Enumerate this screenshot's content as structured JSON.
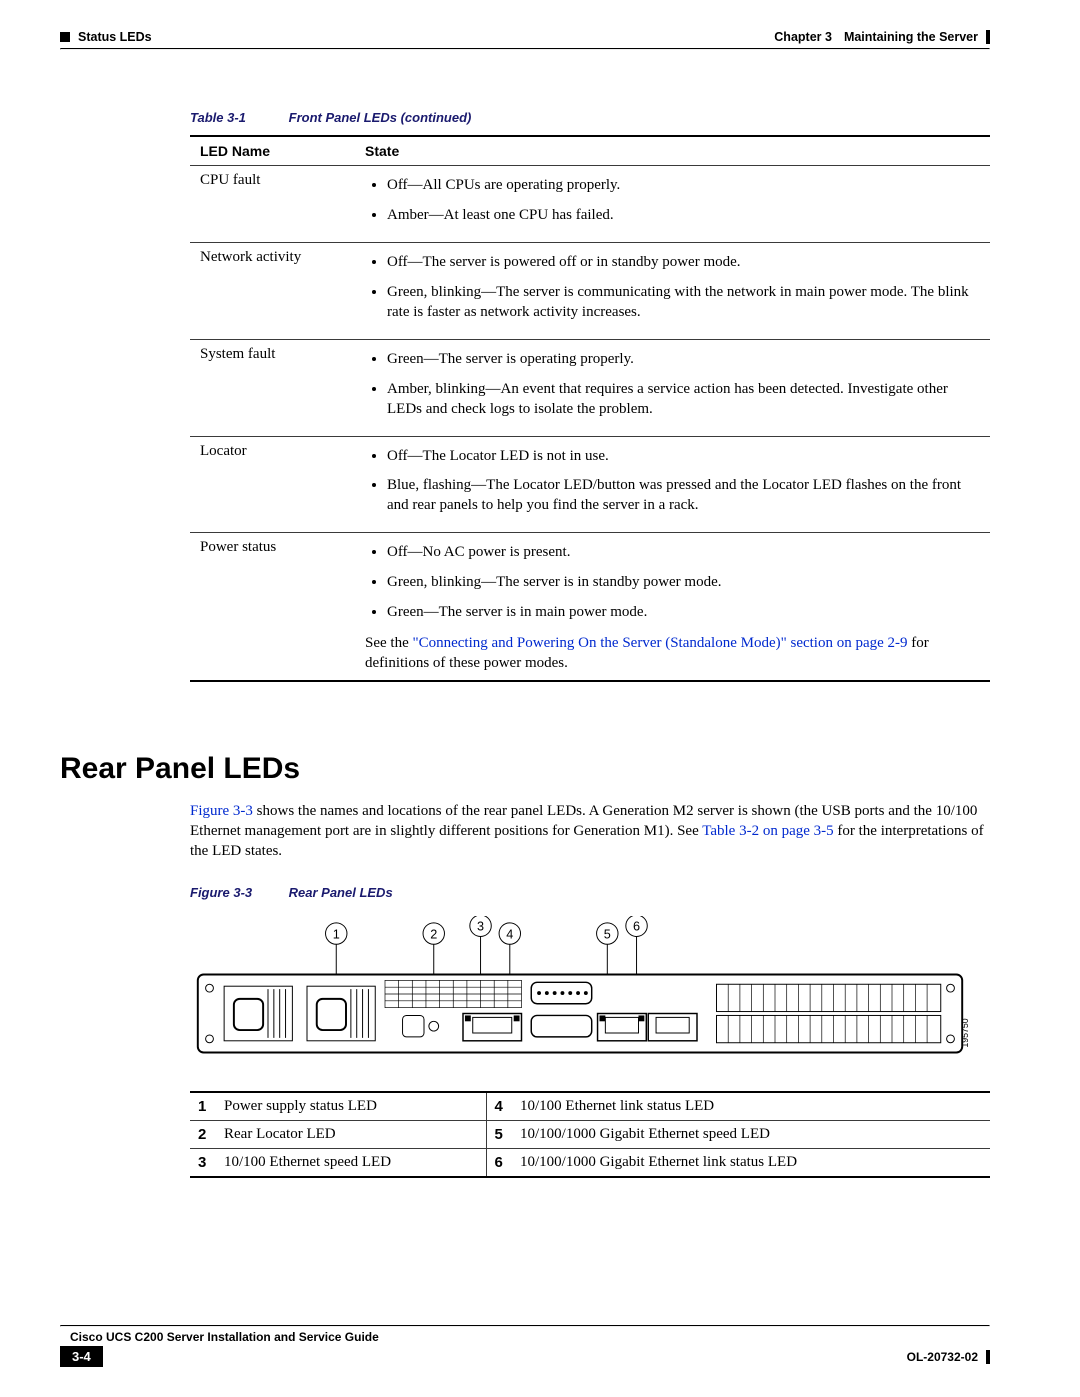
{
  "header": {
    "left": "Status LEDs",
    "chapter": "Chapter 3",
    "right": "Maintaining the Server"
  },
  "table31": {
    "caption_num": "Table 3-1",
    "caption_title": "Front Panel LEDs (continued)",
    "col1": "LED Name",
    "col2": "State",
    "rows": [
      {
        "name": "CPU fault",
        "states": [
          "Off—All CPUs are operating properly.",
          "Amber—At least one CPU has failed."
        ]
      },
      {
        "name": "Network activity",
        "states": [
          "Off—The server is powered off or in standby power mode.",
          "Green, blinking—The server is communicating with the network in main power mode. The blink rate is faster as network activity increases."
        ]
      },
      {
        "name": "System fault",
        "states": [
          "Green—The server is operating properly.",
          "Amber, blinking—An event that requires a service action has been detected. Investigate other LEDs and check logs to isolate the problem."
        ]
      },
      {
        "name": "Locator",
        "states": [
          "Off—The Locator LED is not in use.",
          "Blue, flashing—The Locator LED/button was pressed and the Locator LED flashes on the front and rear panels to help you find the server in a rack."
        ]
      },
      {
        "name": "Power status",
        "states": [
          "Off—No AC power is present.",
          "Green, blinking—The server is in standby power mode.",
          "Green—The server is in main power mode."
        ],
        "see_prefix": "See the ",
        "see_link": "\"Connecting and Powering On the Server (Standalone Mode)\" section on page 2-9",
        "see_suffix": " for definitions of these power modes."
      }
    ]
  },
  "section_heading": "Rear Panel LEDs",
  "body_para": {
    "link1": "Figure 3-3",
    "mid1": " shows the names and locations of the rear panel LEDs. A Generation M2 server is shown (the USB ports and the 10/100 Ethernet management port are in slightly different positions for Generation M1). See ",
    "link2": "Table 3-2 on page 3-5",
    "mid2": " for the interpretations of the LED states."
  },
  "figure": {
    "caption_num": "Figure 3-3",
    "caption_title": "Rear Panel LEDs",
    "tag": "195750"
  },
  "callouts": {
    "r1_num": "1",
    "r1_label": "Power supply status LED",
    "r1b_num": "4",
    "r1b_label": "10/100 Ethernet link status LED",
    "r2_num": "2",
    "r2_label": "Rear Locator LED",
    "r2b_num": "5",
    "r2b_label": "10/100/1000 Gigabit Ethernet speed LED",
    "r3_num": "3",
    "r3_label": "10/100 Ethernet speed LED",
    "r3b_num": "6",
    "r3b_label": "10/100/1000 Gigabit Ethernet link status LED"
  },
  "footer": {
    "pagenum": "3-4",
    "title": "Cisco UCS C200 Server Installation and Service Guide",
    "docref": "OL-20732-02"
  }
}
